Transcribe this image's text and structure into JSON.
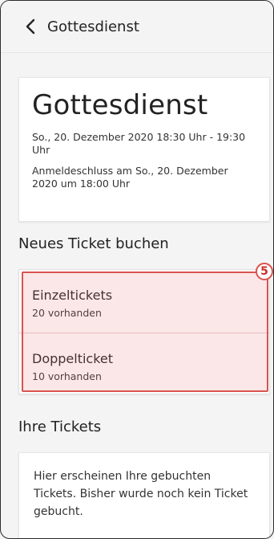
{
  "header": {
    "title": "Gottesdienst",
    "back_icon": "chevron-left-icon"
  },
  "event": {
    "title": "Gottesdienst",
    "date": "So., 20. Dezember 2020 18:30 Uhr - 19:30 Uhr",
    "deadline": "Anmeldeschluss am So., 20. Dezember 2020 um 18:00 Uhr"
  },
  "sections": {
    "new_ticket": "Neues Ticket buchen",
    "your_tickets": "Ihre Tickets"
  },
  "tickets": [
    {
      "name": "Einzeltickets",
      "available": "20 vorhanden"
    },
    {
      "name": "Doppelticket",
      "available": "10 vorhanden"
    }
  ],
  "annotation": {
    "badge": "5",
    "color": "#d9534f"
  },
  "empty_state": {
    "text": "Hier erscheinen Ihre gebuchten Tickets. Bisher wurde noch kein Ticket gebucht."
  }
}
